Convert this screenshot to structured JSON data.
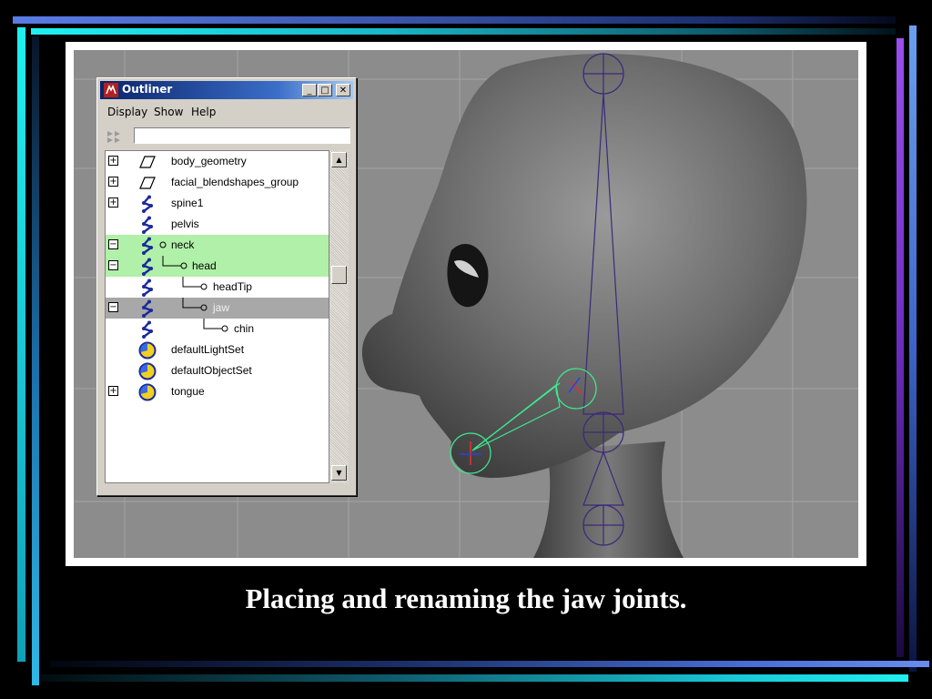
{
  "slide": {
    "caption": "Placing and renaming the jaw joints."
  },
  "outliner": {
    "title": "Outliner",
    "title_icon": "maya-app-icon",
    "window_buttons": [
      "minimize",
      "maximize",
      "close"
    ],
    "menu": [
      "Display",
      "Show",
      "Help"
    ],
    "filter_placeholder": "",
    "items": [
      {
        "label": "body_geometry",
        "icon": "transform-icon",
        "expander": "+",
        "state": "normal"
      },
      {
        "label": "facial_blendshapes_group",
        "icon": "transform-icon",
        "expander": "+",
        "state": "normal"
      },
      {
        "label": "spine1",
        "icon": "joint-icon",
        "expander": "+",
        "state": "normal"
      },
      {
        "label": "pelvis",
        "icon": "joint-icon",
        "expander": "",
        "state": "normal"
      },
      {
        "label": "neck",
        "icon": "joint-icon",
        "expander": "−",
        "state": "selected-green"
      },
      {
        "label": "head",
        "icon": "joint-icon",
        "expander": "−",
        "state": "selected-green"
      },
      {
        "label": "headTip",
        "icon": "joint-icon",
        "expander": "",
        "state": "normal"
      },
      {
        "label": "jaw",
        "icon": "joint-icon",
        "expander": "−",
        "state": "selected-gray"
      },
      {
        "label": "chin",
        "icon": "joint-icon",
        "expander": "",
        "state": "normal"
      },
      {
        "label": "defaultLightSet",
        "icon": "set-icon",
        "expander": "",
        "state": "normal"
      },
      {
        "label": "defaultObjectSet",
        "icon": "set-icon",
        "expander": "",
        "state": "normal"
      },
      {
        "label": "tongue",
        "icon": "set-icon",
        "expander": "+",
        "state": "normal"
      }
    ]
  },
  "colors": {
    "highlight_green": "#b0f0a8",
    "highlight_gray": "#a8a8a8",
    "joint_bone_purple": "#3a2a7a",
    "jaw_bone_green": "#40e890",
    "titlebar_blue": "#0a246a"
  }
}
